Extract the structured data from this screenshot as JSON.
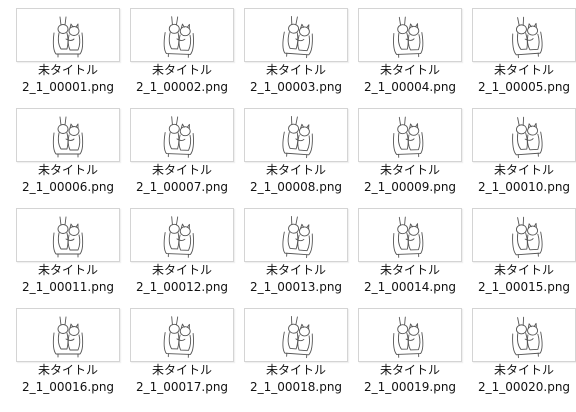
{
  "window": {
    "view": "large-icons"
  },
  "colors": {
    "background": "#ffffff",
    "thumb_border": "#d4d4d4",
    "text": "#111111",
    "sketch": "#555555"
  },
  "files": [
    {
      "title": "未タイトル",
      "filename": "2_1_00001.png",
      "icon": "sketch-thumbnail"
    },
    {
      "title": "未タイトル",
      "filename": "2_1_00002.png",
      "icon": "sketch-thumbnail"
    },
    {
      "title": "未タイトル",
      "filename": "2_1_00003.png",
      "icon": "sketch-thumbnail"
    },
    {
      "title": "未タイトル",
      "filename": "2_1_00004.png",
      "icon": "sketch-thumbnail"
    },
    {
      "title": "未タイトル",
      "filename": "2_1_00005.png",
      "icon": "sketch-thumbnail"
    },
    {
      "title": "未タイトル",
      "filename": "2_1_00006.png",
      "icon": "sketch-thumbnail"
    },
    {
      "title": "未タイトル",
      "filename": "2_1_00007.png",
      "icon": "sketch-thumbnail"
    },
    {
      "title": "未タイトル",
      "filename": "2_1_00008.png",
      "icon": "sketch-thumbnail"
    },
    {
      "title": "未タイトル",
      "filename": "2_1_00009.png",
      "icon": "sketch-thumbnail"
    },
    {
      "title": "未タイトル",
      "filename": "2_1_00010.png",
      "icon": "sketch-thumbnail"
    },
    {
      "title": "未タイトル",
      "filename": "2_1_00011.png",
      "icon": "sketch-thumbnail"
    },
    {
      "title": "未タイトル",
      "filename": "2_1_00012.png",
      "icon": "sketch-thumbnail"
    },
    {
      "title": "未タイトル",
      "filename": "2_1_00013.png",
      "icon": "sketch-thumbnail"
    },
    {
      "title": "未タイトル",
      "filename": "2_1_00014.png",
      "icon": "sketch-thumbnail"
    },
    {
      "title": "未タイトル",
      "filename": "2_1_00015.png",
      "icon": "sketch-thumbnail"
    },
    {
      "title": "未タイトル",
      "filename": "2_1_00016.png",
      "icon": "sketch-thumbnail"
    },
    {
      "title": "未タイトル",
      "filename": "2_1_00017.png",
      "icon": "sketch-thumbnail"
    },
    {
      "title": "未タイトル",
      "filename": "2_1_00018.png",
      "icon": "sketch-thumbnail"
    },
    {
      "title": "未タイトル",
      "filename": "2_1_00019.png",
      "icon": "sketch-thumbnail"
    },
    {
      "title": "未タイトル",
      "filename": "2_1_00020.png",
      "icon": "sketch-thumbnail"
    }
  ]
}
